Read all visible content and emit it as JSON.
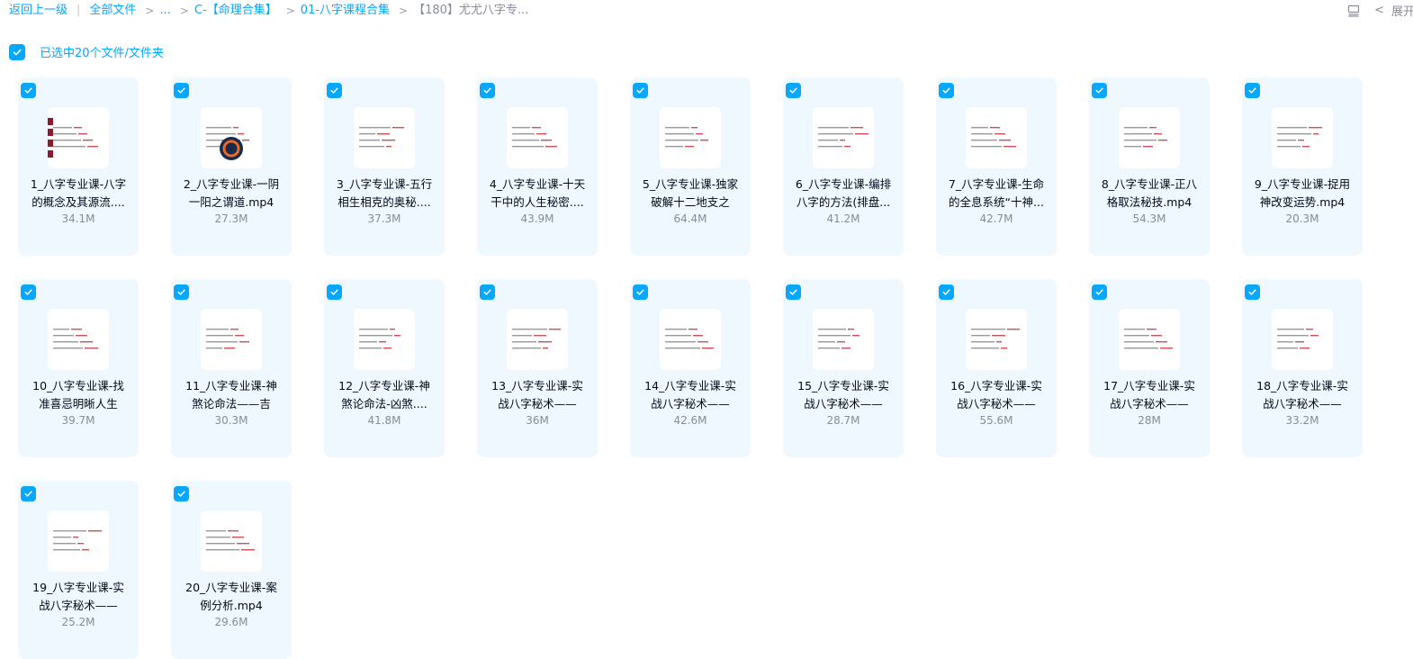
{
  "breadcrumb": {
    "back": "返回上一级",
    "all_files": "全部文件",
    "ellipsis": "...",
    "level1": "C-【命理合集】",
    "level2": "01-八字课程合集",
    "current": "【180】尤尤八字专..."
  },
  "topright": {
    "expand_label": "展开",
    "list_icon": "list-view-icon",
    "chevron": "chevron-left-icon"
  },
  "selection": {
    "text": "已选中20个文件/文件夹"
  },
  "colors": {
    "accent": "#06a7ff",
    "card_bg": "#eef8fe",
    "text": "#03081a",
    "muted": "#878c9c"
  },
  "files": [
    {
      "line1": "1_八字专业课-八字",
      "line2": "的概念及其源流....",
      "size": "34.1M"
    },
    {
      "line1": "2_八字专业课-一阴",
      "line2": "一阳之谓道.mp4",
      "size": "27.3M"
    },
    {
      "line1": "3_八字专业课-五行",
      "line2": "相生相克的奥秘....",
      "size": "37.3M"
    },
    {
      "line1": "4_八字专业课-十天",
      "line2": "干中的人生秘密....",
      "size": "43.9M"
    },
    {
      "line1": "5_八字专业课-独家",
      "line2": "破解十二地支之",
      "size": "64.4M"
    },
    {
      "line1": "6_八字专业课-编排",
      "line2": "八字的方法(排盘...",
      "size": "41.2M"
    },
    {
      "line1": "7_八字专业课-生命",
      "line2": "的全息系统“十神...",
      "size": "42.7M"
    },
    {
      "line1": "8_八字专业课-正八",
      "line2": "格取法秘技.mp4",
      "size": "54.3M"
    },
    {
      "line1": "9_八字专业课-捉用",
      "line2": "神改变运势.mp4",
      "size": "20.3M"
    },
    {
      "line1": "10_八字专业课-找",
      "line2": "准喜忌明晰人生",
      "size": "39.7M"
    },
    {
      "line1": "11_八字专业课-神",
      "line2": "煞论命法——吉",
      "size": "30.3M"
    },
    {
      "line1": "12_八字专业课-神",
      "line2": "煞论命法-凶煞....",
      "size": "41.8M"
    },
    {
      "line1": "13_八字专业课-实",
      "line2": "战八字秘术——",
      "size": "36M"
    },
    {
      "line1": "14_八字专业课-实",
      "line2": "战八字秘术——",
      "size": "42.6M"
    },
    {
      "line1": "15_八字专业课-实",
      "line2": "战八字秘术——",
      "size": "28.7M"
    },
    {
      "line1": "16_八字专业课-实",
      "line2": "战八字秘术——",
      "size": "55.6M"
    },
    {
      "line1": "17_八字专业课-实",
      "line2": "战八字秘术——",
      "size": "28M"
    },
    {
      "line1": "18_八字专业课-实",
      "line2": "战八字秘术——",
      "size": "33.2M"
    },
    {
      "line1": "19_八字专业课-实",
      "line2": "战八字秘术——",
      "size": "25.2M"
    },
    {
      "line1": "20_八字专业课-案",
      "line2": "例分析.mp4",
      "size": "29.6M"
    }
  ]
}
